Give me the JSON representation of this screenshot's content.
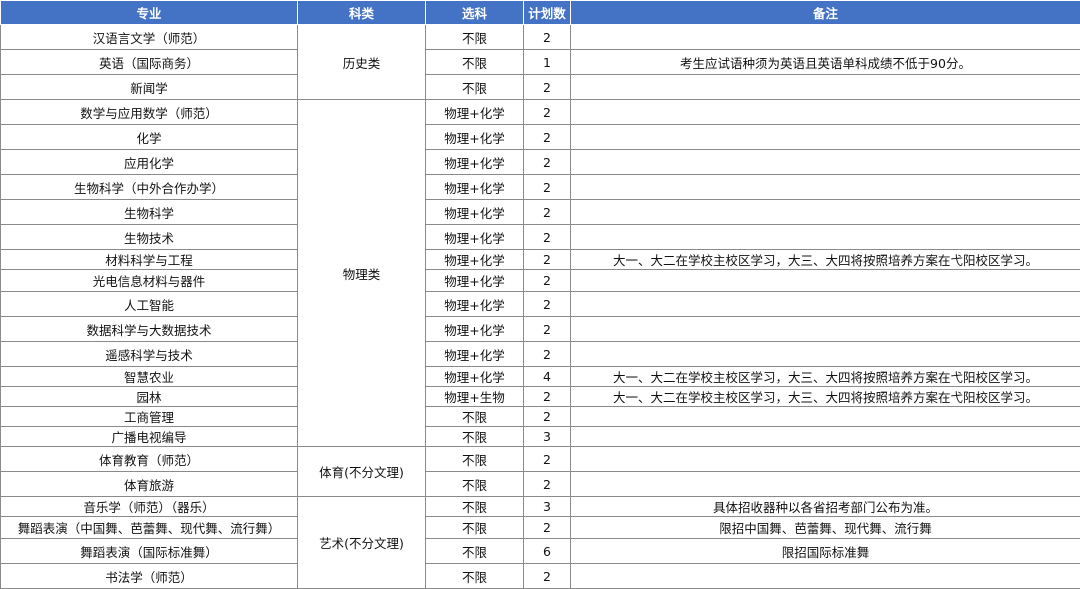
{
  "headers": [
    "专业",
    "科类",
    "选科",
    "计划数",
    "备注"
  ],
  "groups": {
    "history": "历史类",
    "physics": "物理类",
    "pe": "体育(不分文理)",
    "art": "艺术(不分文理)"
  },
  "rows": [
    {
      "major": "汉语言文学（师范）",
      "subject": "不限",
      "count": "2",
      "note": ""
    },
    {
      "major": "英语（国际商务）",
      "subject": "不限",
      "count": "1",
      "note": "考生应试语种须为英语且英语单科成绩不低于90分。"
    },
    {
      "major": "新闻学",
      "subject": "不限",
      "count": "2",
      "note": ""
    },
    {
      "major": "数学与应用数学（师范）",
      "subject": "物理+化学",
      "count": "2",
      "note": ""
    },
    {
      "major": "化学",
      "subject": "物理+化学",
      "count": "2",
      "note": ""
    },
    {
      "major": "应用化学",
      "subject": "物理+化学",
      "count": "2",
      "note": ""
    },
    {
      "major": "生物科学（中外合作办学）",
      "subject": "物理+化学",
      "count": "2",
      "note": ""
    },
    {
      "major": "生物科学",
      "subject": "物理+化学",
      "count": "2",
      "note": ""
    },
    {
      "major": "生物技术",
      "subject": "物理+化学",
      "count": "2",
      "note": ""
    },
    {
      "major": "材料科学与工程",
      "subject": "物理+化学",
      "count": "2",
      "note": "大一、大二在学校主校区学习，大三、大四将按照培养方案在弋阳校区学习。"
    },
    {
      "major": "光电信息材料与器件",
      "subject": "物理+化学",
      "count": "2",
      "note": ""
    },
    {
      "major": "人工智能",
      "subject": "物理+化学",
      "count": "2",
      "note": ""
    },
    {
      "major": "数据科学与大数据技术",
      "subject": "物理+化学",
      "count": "2",
      "note": ""
    },
    {
      "major": "遥感科学与技术",
      "subject": "物理+化学",
      "count": "2",
      "note": ""
    },
    {
      "major": "智慧农业",
      "subject": "物理+化学",
      "count": "4",
      "note": "大一、大二在学校主校区学习，大三、大四将按照培养方案在弋阳校区学习。"
    },
    {
      "major": "园林",
      "subject": "物理+生物",
      "count": "2",
      "note": "大一、大二在学校主校区学习，大三、大四将按照培养方案在弋阳校区学习。"
    },
    {
      "major": "工商管理",
      "subject": "不限",
      "count": "2",
      "note": ""
    },
    {
      "major": "广播电视编导",
      "subject": "不限",
      "count": "3",
      "note": ""
    },
    {
      "major": "体育教育（师范）",
      "subject": "不限",
      "count": "2",
      "note": ""
    },
    {
      "major": "体育旅游",
      "subject": "不限",
      "count": "2",
      "note": ""
    },
    {
      "major": "音乐学（师范）（器乐）",
      "subject": "不限",
      "count": "3",
      "note": "具体招收器种以各省招考部门公布为准。"
    },
    {
      "major": "舞蹈表演（中国舞、芭蕾舞、现代舞、流行舞）",
      "subject": "不限",
      "count": "2",
      "note": "限招中国舞、芭蕾舞、现代舞、流行舞"
    },
    {
      "major": "舞蹈表演（国际标准舞）",
      "subject": "不限",
      "count": "6",
      "note": "限招国际标准舞"
    },
    {
      "major": "书法学（师范）",
      "subject": "不限",
      "count": "2",
      "note": ""
    }
  ]
}
